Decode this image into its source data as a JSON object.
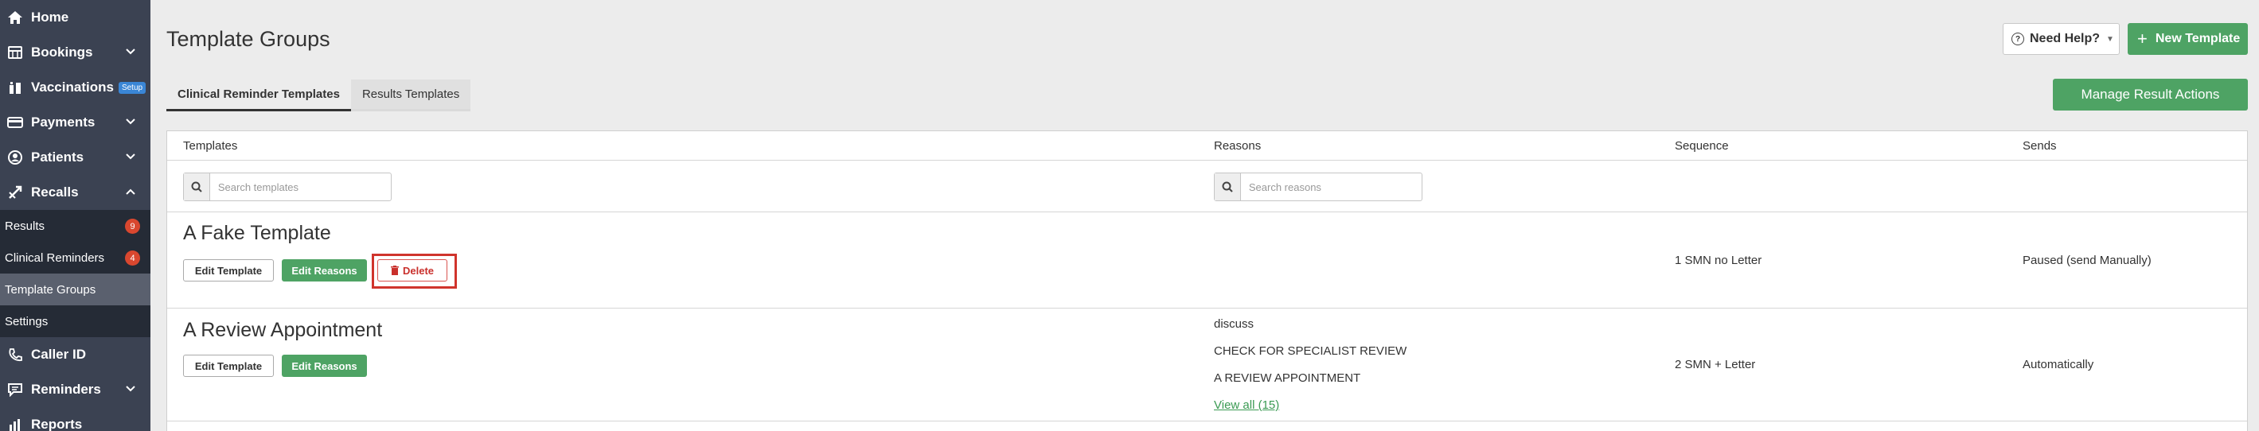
{
  "sidebar": {
    "items": [
      {
        "label": "Home",
        "icon": "home-icon"
      },
      {
        "label": "Bookings",
        "icon": "bookings-icon"
      },
      {
        "label": "Vaccinations",
        "icon": "vaccinations-icon",
        "badge": "Setup"
      },
      {
        "label": "Payments",
        "icon": "payments-icon"
      },
      {
        "label": "Patients",
        "icon": "patients-icon"
      },
      {
        "label": "Recalls",
        "icon": "recalls-icon"
      }
    ],
    "recalls_sub": [
      {
        "label": "Results",
        "count": "9"
      },
      {
        "label": "Clinical Reminders",
        "count": "4"
      },
      {
        "label": "Template Groups"
      },
      {
        "label": "Settings"
      }
    ],
    "after": [
      {
        "label": "Caller ID",
        "icon": "phone-icon"
      },
      {
        "label": "Reminders",
        "icon": "reminders-icon"
      },
      {
        "label": "Reports",
        "icon": "reports-icon"
      }
    ]
  },
  "header": {
    "title": "Template Groups",
    "help_label": "Need Help?",
    "new_label": "New Template"
  },
  "tabs": [
    {
      "label": "Clinical Reminder Templates",
      "active": true
    },
    {
      "label": "Results Templates",
      "active": false
    }
  ],
  "manage_label": "Manage Result Actions",
  "table": {
    "columns": [
      "Templates",
      "Reasons",
      "Sequence",
      "Sends"
    ],
    "search_templates_placeholder": "Search templates",
    "search_reasons_placeholder": "Search reasons",
    "rows": [
      {
        "title": "A Fake Template",
        "edit_template": "Edit Template",
        "edit_reasons": "Edit Reasons",
        "delete": "Delete",
        "reasons": [],
        "sequence": "1 SMN no Letter",
        "sends": "Paused (send Manually)"
      },
      {
        "title": "A Review Appointment",
        "edit_template": "Edit Template",
        "edit_reasons": "Edit Reasons",
        "reasons": [
          "discuss",
          "CHECK FOR SPECIALIST REVIEW",
          "A REVIEW APPOINTMENT"
        ],
        "view_all": "View all (15)",
        "sequence": "2 SMN + Letter",
        "sends": "Automatically"
      }
    ]
  },
  "colors": {
    "sidebar": "#3b4252",
    "sidebar_sub": "#252b36",
    "accent_green": "#4ea364",
    "delete_red": "#d0342c",
    "badge_blue": "#3a86d6"
  }
}
